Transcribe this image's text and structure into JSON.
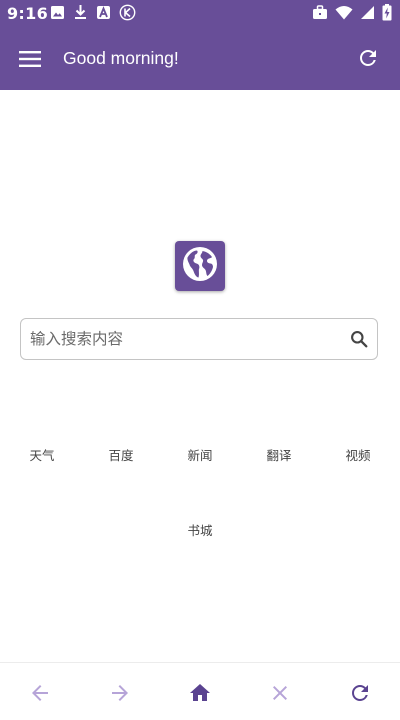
{
  "status_bar": {
    "time": "9:16",
    "left_icons": [
      "image-icon",
      "download-icon",
      "a-app-icon",
      "k-app-icon"
    ],
    "right_icons": [
      "briefcase-icon",
      "wifi-icon",
      "signal-icon",
      "battery-charging-icon"
    ]
  },
  "app_bar": {
    "title": "Good morning!",
    "menu_icon": "hamburger-menu-icon",
    "refresh_icon": "refresh-icon"
  },
  "logo": {
    "icon": "globe-icon"
  },
  "search": {
    "placeholder": "输入搜索内容",
    "value": "",
    "icon": "search-icon"
  },
  "shortcuts": [
    {
      "label": "天气"
    },
    {
      "label": "百度"
    },
    {
      "label": "新闻"
    },
    {
      "label": "翻译"
    },
    {
      "label": "视频"
    },
    {
      "label": "书城"
    }
  ],
  "bottom_nav": [
    {
      "icon": "back-arrow-icon",
      "enabled": false
    },
    {
      "icon": "forward-arrow-icon",
      "enabled": false
    },
    {
      "icon": "home-icon",
      "enabled": true
    },
    {
      "icon": "close-icon",
      "enabled": false
    },
    {
      "icon": "reload-icon",
      "enabled": true
    }
  ],
  "colors": {
    "primary": "#684e98",
    "nav_active": "#5a4390",
    "nav_disabled": "#b6a4d8",
    "text": "#444444"
  }
}
